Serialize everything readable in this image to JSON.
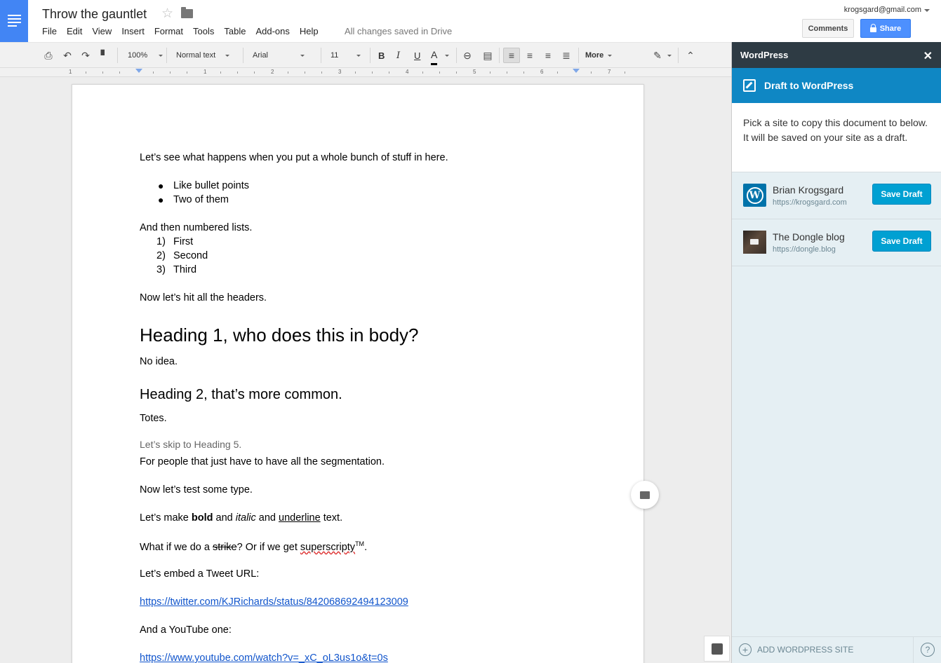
{
  "header": {
    "title": "Throw the gauntlet",
    "menu": [
      "File",
      "Edit",
      "View",
      "Insert",
      "Format",
      "Tools",
      "Table",
      "Add-ons",
      "Help"
    ],
    "saved_status": "All changes saved in Drive",
    "account_email": "krogsgard@gmail.com",
    "comments_label": "Comments",
    "share_label": "Share"
  },
  "toolbar": {
    "zoom": "100%",
    "style": "Normal text",
    "font": "Arial",
    "font_size": "11",
    "bold_label": "B",
    "italic_label": "I",
    "underline_label": "U",
    "text_color_label": "A",
    "more_label": "More"
  },
  "ruler": {
    "labels": [
      "1",
      "1",
      "2",
      "3",
      "4",
      "5",
      "6",
      "7"
    ]
  },
  "document": {
    "intro": "Let’s see what happens when you put a whole bunch of stuff in here.",
    "bullets": [
      "Like bullet points",
      "Two of them"
    ],
    "numbered_intro": "And then numbered lists.",
    "numbered": [
      {
        "n": "1)",
        "text": "First"
      },
      {
        "n": "2)",
        "text": "Second"
      },
      {
        "n": "3)",
        "text": "Third"
      }
    ],
    "headers_intro": "Now let’s hit all the headers.",
    "h1": "Heading 1, who does this in body?",
    "h1_body": "No idea.",
    "h2": "Heading 2, that’s more common.",
    "h2_body": "Totes.",
    "h5": "Let’s skip to Heading 5.",
    "h5_body": "For people that just have to have all the segmentation.",
    "type_intro": "Now let’s test some type.",
    "type_line": {
      "pre": "Let’s make ",
      "bold": "bold",
      "mid1": " and ",
      "italic": "italic",
      "mid2": " and ",
      "underline": "underline",
      "post": " text."
    },
    "strike_line": {
      "pre": "What if we do a ",
      "strike": "strike",
      "mid": "? Or if we get ",
      "sup": "superscripty",
      "tm": "TM",
      "post": "."
    },
    "tweet_intro": "Let’s embed a Tweet URL:",
    "tweet_url": "https://twitter.com/KJRichards/status/842068692494123009",
    "youtube_intro": "And a YouTube one:",
    "youtube_url": "https://www.youtube.com/watch?v=_xC_oL3us1o&t=0s"
  },
  "sidebar": {
    "header": "WordPress",
    "close": "✕",
    "banner": "Draft to WordPress",
    "description": "Pick a site to copy this document to below. It will be saved on your site as a draft.",
    "sites": [
      {
        "name": "Brian Krogsgard",
        "url": "https://krogsgard.com",
        "button": "Save Draft"
      },
      {
        "name": "The Dongle blog",
        "url": "https://dongle.blog",
        "button": "Save Draft"
      }
    ],
    "add_site": "ADD WORDPRESS SITE",
    "help": "?"
  }
}
